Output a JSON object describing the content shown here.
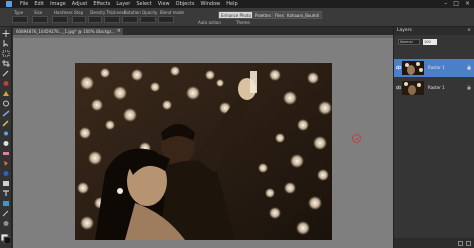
{
  "menubar": {
    "items": [
      "File",
      "Edit",
      "Image",
      "Adjust",
      "Effects",
      "Layer",
      "Select",
      "View",
      "Objects",
      "Window",
      "Help"
    ]
  },
  "options": {
    "labels": [
      "Type",
      "Size",
      "Hardness",
      "Step",
      "Density",
      "Thickness",
      "Rotation",
      "Opacity",
      "Blend mode",
      "Stroke",
      "Head tracking",
      "Variation"
    ],
    "buttons": [
      "Enhance Photo",
      "Palettes",
      "Files",
      "Kahaani_Bouhdi"
    ],
    "auto_action": "Auto action",
    "theme": "Theme"
  },
  "document": {
    "tab_title": "60894876_10459276..._1.jpg* @ 100% (Backgr...",
    "close": "×"
  },
  "layers": {
    "title": "Layers",
    "close": "×",
    "blend_mode": "Normal",
    "opacity": "100",
    "rows": [
      {
        "name": "Raster 1",
        "selected": true
      },
      {
        "name": "Raster 1",
        "selected": false
      }
    ]
  },
  "colors": {
    "selection": "#4b7fc8",
    "canvas_bg": "#7f7f7f",
    "sepia_dark": "#2a1c12"
  }
}
